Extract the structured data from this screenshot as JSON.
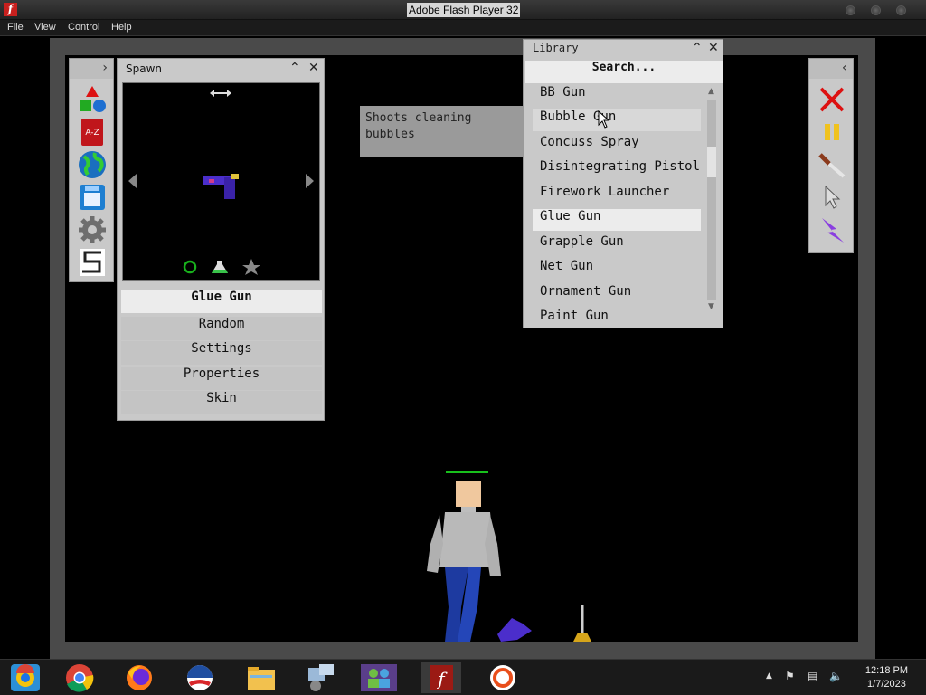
{
  "window": {
    "title": "Adobe Flash Player 32"
  },
  "menu": {
    "items": [
      "File",
      "View",
      "Control",
      "Help"
    ]
  },
  "spawn": {
    "title": "Spawn",
    "selected_item": "Glue Gun",
    "options": [
      "Random",
      "Settings",
      "Properties",
      "Skin"
    ]
  },
  "tooltip": {
    "text_line1": "Shoots cleaning",
    "text_line2": "bubbles"
  },
  "library": {
    "title": "Library",
    "search_placeholder": "Search...",
    "items": [
      "BB Gun",
      "Bubble Gun",
      "Concuss Spray",
      "Disintegrating Pistol",
      "Firework Launcher",
      "Glue Gun",
      "Grapple Gun",
      "Net Gun",
      "Ornament Gun",
      "Paint Gun"
    ],
    "selected_index": 5,
    "hover_index": 1
  },
  "left_toolbar": {
    "icons": [
      "shapes-icon",
      "dictionary-icon",
      "globe-icon",
      "save-icon",
      "settings-gear-icon",
      "s-logo-icon"
    ]
  },
  "right_toolbar": {
    "icons": [
      "delete-x-icon",
      "pause-icon",
      "knife-icon",
      "pointer-icon",
      "lightning-icon"
    ]
  },
  "taskbar": {
    "apps": [
      "chrome-like-icon",
      "chrome-icon",
      "firefox-icon",
      "obama-logo-icon",
      "file-explorer-icon",
      "network-admin-icon",
      "people-icon",
      "flash-player-icon",
      "settings-icon"
    ],
    "time": "12:18 PM",
    "date": "1/7/2023"
  },
  "colors": {
    "panel": "#c9c9c9",
    "selected": "#ececec",
    "stage": "#000000",
    "accent_purple": "#6b3ecf"
  }
}
